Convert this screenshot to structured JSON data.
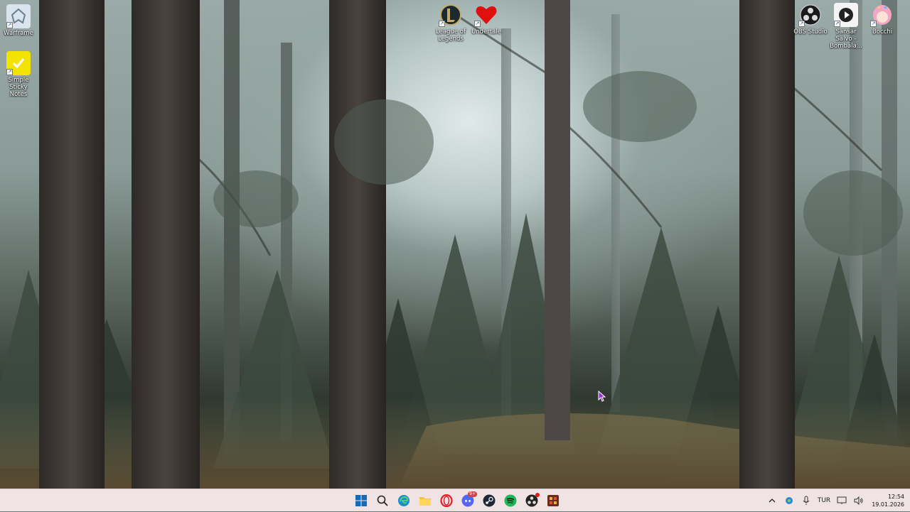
{
  "desktop": {
    "icons_left": [
      {
        "name": "warframe",
        "label": "Warframe"
      },
      {
        "name": "simple-sticky-notes",
        "label": "Simple Sticky Notes"
      }
    ],
    "icons_top": [
      {
        "name": "league-of-legends",
        "label": "League of Legends"
      },
      {
        "name": "undertale",
        "label": "Undertale"
      }
    ],
    "icons_right": [
      {
        "name": "obs-studio",
        "label": "OBS Studio"
      },
      {
        "name": "sansar-salvo",
        "label": "Sansar Salvo - Bombala..."
      },
      {
        "name": "bocchi",
        "label": "Bocchi"
      }
    ]
  },
  "taskbar": {
    "apps": [
      "start",
      "search",
      "edge",
      "file-explorer",
      "opera",
      "discord",
      "steam",
      "spotify",
      "obs",
      "app"
    ],
    "discord_badge": "9+",
    "tray": {
      "language": "TUR",
      "time": "12:54",
      "date": "19.01.2026"
    }
  },
  "colors": {
    "taskbar_bg": "#efe3e4",
    "start_blue": "#0f6cbd",
    "discord": "#5865f2",
    "spotify": "#1db954",
    "undertale_red": "#e01010"
  }
}
